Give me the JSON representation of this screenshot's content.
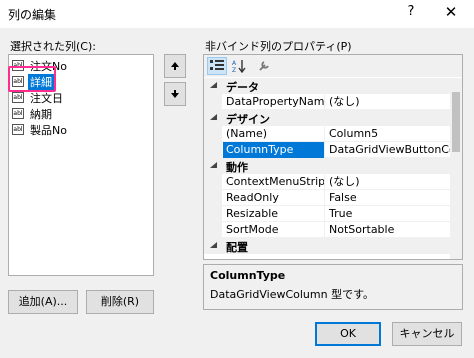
{
  "window": {
    "title": "列の編集",
    "help_glyph": "?",
    "close_glyph": "✕"
  },
  "left": {
    "label": "選択された列(C):",
    "items": [
      {
        "icon": "abl",
        "label": "注文No"
      },
      {
        "icon": "abl",
        "label": "詳細"
      },
      {
        "icon": "abl",
        "label": "注文日"
      },
      {
        "icon": "abl",
        "label": "納期"
      },
      {
        "icon": "abl",
        "label": "製品No"
      }
    ],
    "selected_index": 1,
    "add_button": "追加(A)...",
    "remove_button": "削除(R)"
  },
  "right": {
    "label": "非バインド列のプロパティ(P)",
    "toolbar": [
      "categorized-icon",
      "alphabetical-icon",
      "property-pages-icon"
    ],
    "categories": [
      {
        "name": "データ",
        "rows": [
          {
            "name": "DataPropertyName",
            "value": "(なし)"
          }
        ]
      },
      {
        "name": "デザイン",
        "rows": [
          {
            "name": "(Name)",
            "value": "Column5"
          },
          {
            "name": "ColumnType",
            "value": "DataGridViewButtonColu"
          }
        ]
      },
      {
        "name": "動作",
        "rows": [
          {
            "name": "ContextMenuStrip",
            "value": "(なし)"
          },
          {
            "name": "ReadOnly",
            "value": "False"
          },
          {
            "name": "Resizable",
            "value": "True"
          },
          {
            "name": "SortMode",
            "value": "NotSortable"
          }
        ]
      },
      {
        "name": "配置",
        "rows": []
      }
    ],
    "description": {
      "title": "ColumnType",
      "text": "DataGridViewColumn 型です。"
    }
  },
  "buttons": {
    "ok": "OK",
    "cancel": "キャンセル"
  },
  "colors": {
    "selection": "#0078d7",
    "annotation_box": "#ff2d8f"
  }
}
